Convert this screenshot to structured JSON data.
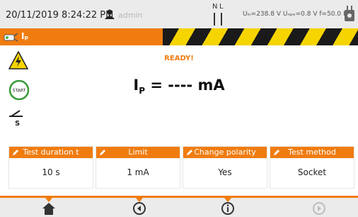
{
  "status_bar": {
    "datetime": "20/11/2019 8:24:22 PM",
    "user": "admin",
    "phase_n": "N",
    "phase_l": "L",
    "measurement": "Uₗₙ=238.8 V Uₙₚₑ=0.8 V f=50.0 Hz"
  },
  "banner": {
    "title": "Iₚ",
    "accent_color": "#f07c10"
  },
  "main": {
    "state": "READY!",
    "reading_symbol": "I",
    "reading_sub": "P",
    "reading_value": " = ---- mA"
  },
  "params": [
    {
      "label": "Test duration t",
      "value": "10 s"
    },
    {
      "label": "Limit",
      "value": "1 mA"
    },
    {
      "label": "Change polarity",
      "value": "Yes"
    },
    {
      "label": "Test method",
      "value": "Socket"
    }
  ],
  "icons": {
    "left": [
      "high-voltage-warning-icon",
      "start-icon",
      "switch-s-icon"
    ],
    "bottom": [
      "home-icon",
      "back-icon",
      "info-icon",
      "forward-icon"
    ]
  }
}
